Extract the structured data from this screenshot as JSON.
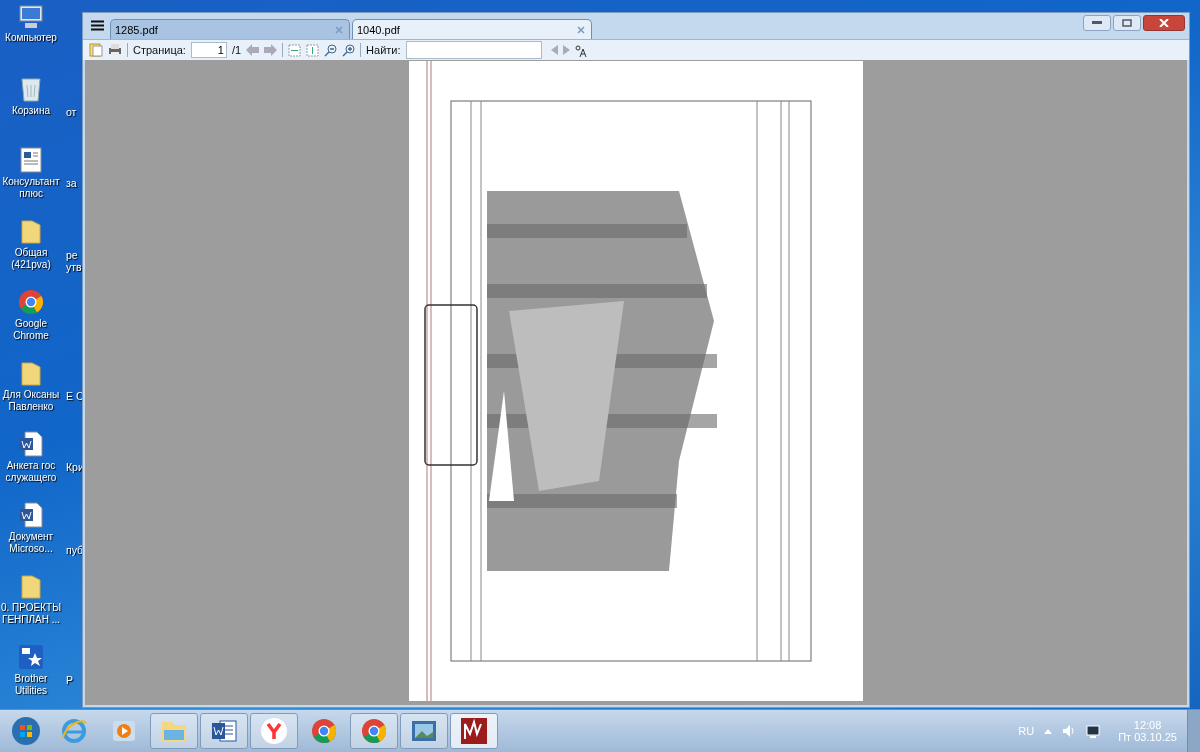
{
  "desktop_icons": [
    {
      "kind": "computer",
      "label": "Компьютер"
    },
    {
      "kind": "bin",
      "label": "Корзина"
    },
    {
      "kind": "doc",
      "label": "Консультант плюс"
    },
    {
      "kind": "folder",
      "label": "Общая (421pva)"
    },
    {
      "kind": "chrome",
      "label": "Google Chrome"
    },
    {
      "kind": "folder",
      "label": "Для Оксаны Павленко"
    },
    {
      "kind": "word",
      "label": "Анкета гос служащего"
    },
    {
      "kind": "word",
      "label": "Документ Microsо..."
    },
    {
      "kind": "folder",
      "label": "0. ПРОЕКТЫ ГЕНПЛАН ..."
    },
    {
      "kind": "brother",
      "label": "Brother Utilities"
    }
  ],
  "desktop_icons_column_2": [
    "от",
    "за",
    "ре утв",
    "Е С",
    "Кри",
    "пуб",
    "Р"
  ],
  "viewer": {
    "tabs": [
      {
        "label": "1285.pdf",
        "selected": false
      },
      {
        "label": "1040.pdf",
        "selected": true
      }
    ],
    "toolbar": {
      "page_label": "Страница:",
      "page_value": "1",
      "page_total": "/1",
      "find_label": "Найти:"
    }
  },
  "taskbar": {
    "apps": [
      {
        "kind": "ie",
        "pinned": true,
        "active": false
      },
      {
        "kind": "media",
        "pinned": true,
        "active": false
      },
      {
        "kind": "explorer",
        "pinned": false,
        "active": false
      },
      {
        "kind": "word",
        "pinned": false,
        "active": false
      },
      {
        "kind": "yandex",
        "pinned": false,
        "active": false
      },
      {
        "kind": "chrome",
        "pinned": true,
        "active": false
      },
      {
        "kind": "chrome",
        "pinned": false,
        "active": false
      },
      {
        "kind": "photos",
        "pinned": false,
        "active": false
      },
      {
        "kind": "pdf",
        "pinned": false,
        "active": true
      }
    ],
    "language": "RU",
    "time": "12:08",
    "date": "Пт 03.10.25"
  }
}
